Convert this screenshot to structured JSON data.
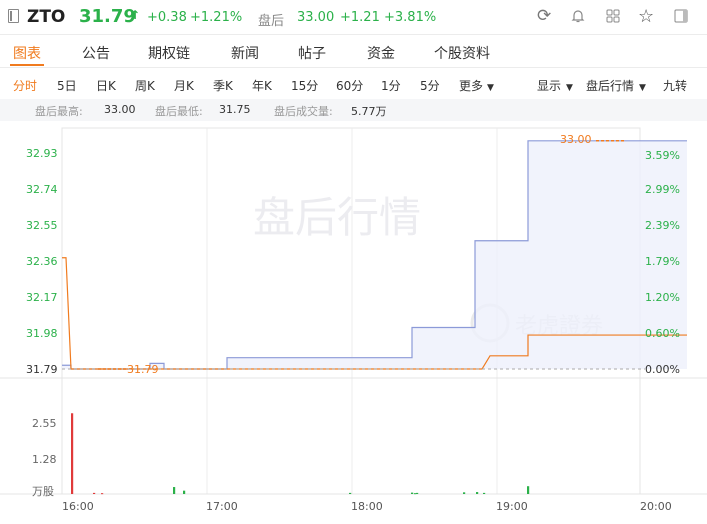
{
  "header": {
    "ticker": "ZTO",
    "price": "31.79",
    "arrow": "↑",
    "change": "+0.38",
    "change_pct": "+1.21%",
    "after_hours_label": "盘后",
    "ah_price": "33.00",
    "ah_change": "+1.21",
    "ah_change_pct": "+3.81%"
  },
  "tabs": [
    "图表",
    "公告",
    "期权链",
    "新闻",
    "帖子",
    "资金",
    "个股资料"
  ],
  "periods": [
    "分时",
    "5日",
    "日K",
    "周K",
    "月K",
    "季K",
    "年K",
    "15分",
    "60分",
    "1分",
    "5分",
    "更多"
  ],
  "right_controls": {
    "show": "显示",
    "after_hours": "盘后行情",
    "nine": "九转"
  },
  "info": {
    "high_label": "盘后最高:",
    "high": "33.00",
    "low_label": "盘后最低:",
    "low": "31.75",
    "volume_label": "盘后成交量:",
    "volume": "5.77万"
  },
  "watermark": {
    "title": "盘后行情",
    "brand": "老虎證券"
  },
  "chart_data": {
    "type": "line",
    "y_left": [
      "32.93",
      "32.74",
      "32.55",
      "32.36",
      "32.17",
      "31.98",
      "31.79"
    ],
    "y_right": [
      "3.59%",
      "2.99%",
      "2.39%",
      "1.79%",
      "1.20%",
      "0.60%",
      "0.00%"
    ],
    "baseline": "31.79",
    "last_price": "33.00",
    "x_ticks": [
      "16:00",
      "17:00",
      "18:00",
      "19:00",
      "20:00"
    ],
    "volume_ticks": [
      "2.55",
      "1.28"
    ],
    "volume_unit": "万股",
    "series": [
      {
        "color": "#8c9ad8",
        "points": [
          [
            0,
            31.81
          ],
          [
            9,
            31.81
          ],
          [
            9,
            31.79
          ],
          [
            88,
            31.79
          ],
          [
            88,
            31.82
          ],
          [
            102,
            31.82
          ],
          [
            102,
            31.79
          ],
          [
            165,
            31.79
          ],
          [
            165,
            31.85
          ],
          [
            350,
            31.85
          ],
          [
            350,
            32.01
          ],
          [
            413,
            32.01
          ],
          [
            413,
            32.47
          ],
          [
            466,
            32.47
          ],
          [
            466,
            33.0
          ],
          [
            625,
            33.0
          ]
        ]
      },
      {
        "color": "#f07b1f",
        "points": [
          [
            0,
            32.38
          ],
          [
            4,
            32.38
          ],
          [
            9,
            31.79
          ],
          [
            420,
            31.79
          ],
          [
            428,
            31.86
          ],
          [
            466,
            31.86
          ],
          [
            466,
            31.97
          ],
          [
            625,
            31.97
          ]
        ]
      }
    ],
    "volumes": [
      {
        "x": 10,
        "v": 2.9,
        "color": "#e03a3a"
      },
      {
        "x": 32,
        "v": 0.04,
        "color": "#e03a3a"
      },
      {
        "x": 40,
        "v": 0.03,
        "color": "#e03a3a"
      },
      {
        "x": 112,
        "v": 0.25,
        "color": "#2bb14a"
      },
      {
        "x": 122,
        "v": 0.12,
        "color": "#2bb14a"
      },
      {
        "x": 288,
        "v": 0.04,
        "color": "#2bb14a"
      },
      {
        "x": 350,
        "v": 0.05,
        "color": "#2bb14a"
      },
      {
        "x": 353,
        "v": 0.03,
        "color": "#2bb14a"
      },
      {
        "x": 402,
        "v": 0.06,
        "color": "#2bb14a"
      },
      {
        "x": 355,
        "v": 0.04,
        "color": "#2bb14a"
      },
      {
        "x": 415,
        "v": 0.07,
        "color": "#2bb14a"
      },
      {
        "x": 422,
        "v": 0.04,
        "color": "#2bb14a"
      },
      {
        "x": 466,
        "v": 0.28,
        "color": "#2bb14a"
      }
    ]
  }
}
